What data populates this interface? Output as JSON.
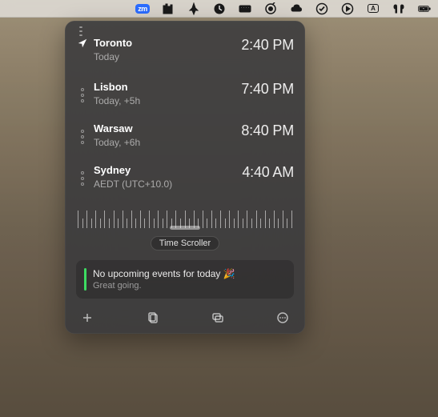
{
  "menubar": {
    "items": [
      {
        "name": "zoom-icon",
        "label": "zm"
      },
      {
        "name": "equalizer-icon"
      },
      {
        "name": "rocket-icon"
      },
      {
        "name": "clock-icon"
      },
      {
        "name": "keyboard-icon"
      },
      {
        "name": "vpn-icon"
      },
      {
        "name": "cloud-icon"
      },
      {
        "name": "task-check-icon"
      },
      {
        "name": "play-icon"
      },
      {
        "name": "text-box-icon",
        "label": "A"
      },
      {
        "name": "airpods-icon"
      },
      {
        "name": "battery-charging-icon"
      }
    ]
  },
  "panel": {
    "zones": [
      {
        "city": "Toronto",
        "sub": "Today",
        "time": "2:40 PM",
        "is_current": true
      },
      {
        "city": "Lisbon",
        "sub": "Today, +5h",
        "time": "7:40 PM",
        "is_current": false
      },
      {
        "city": "Warsaw",
        "sub": "Today, +6h",
        "time": "8:40 PM",
        "is_current": false
      },
      {
        "city": "Sydney",
        "sub": "AEDT (UTC+10.0)",
        "time": "4:40 AM",
        "is_current": false
      }
    ],
    "scroller_label": "Time Scroller",
    "event": {
      "title": "No upcoming events for today 🎉",
      "subtitle": "Great going.",
      "accent": "#3ddc62"
    },
    "footer": {
      "add": "add",
      "copy": "copy",
      "window": "window",
      "more": "more"
    }
  }
}
